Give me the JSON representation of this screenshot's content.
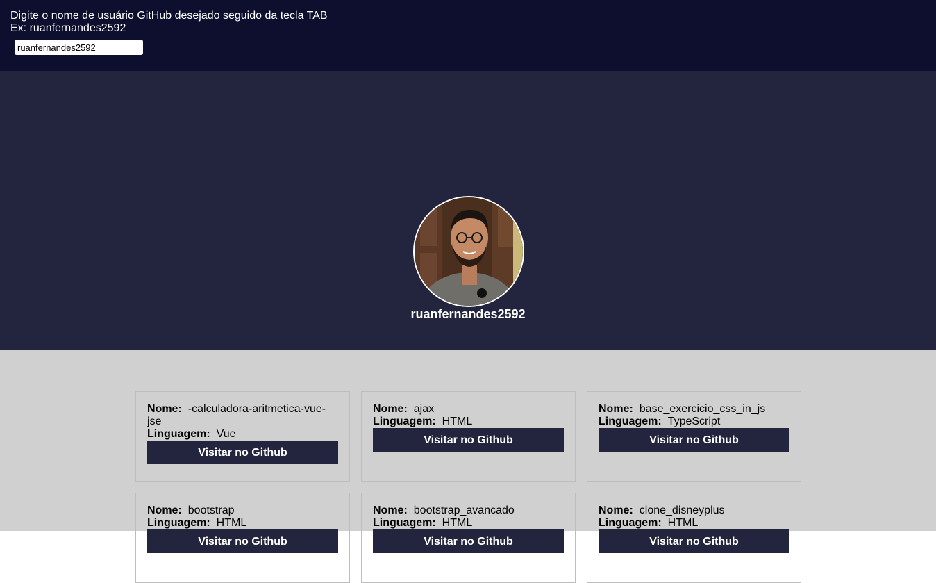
{
  "header": {
    "instruction_line1": "Digite o nome de usuário GitHub desejado seguido da tecla TAB",
    "instruction_line2": "Ex: ruanfernandes2592",
    "username_value": "ruanfernandes2592"
  },
  "profile": {
    "username": "ruanfernandes2592"
  },
  "labels": {
    "name": "Nome:",
    "language": "Linguagem:",
    "visit": "Visitar no Github"
  },
  "repos": [
    {
      "name": "-calculadora-aritmetica-vue-jse",
      "name_line1": "-calculadora-aritmetica-vue-",
      "name_line2": "jse",
      "language": "Vue"
    },
    {
      "name": "ajax",
      "language": "HTML"
    },
    {
      "name": "base_exercicio_css_in_js",
      "language": "TypeScript"
    },
    {
      "name": "bootstrap",
      "language": "HTML"
    },
    {
      "name": "bootstrap_avancado",
      "language": "HTML"
    },
    {
      "name": "clone_disneyplus",
      "language": "HTML"
    }
  ],
  "colors": {
    "header_bg": "#0e0f2e",
    "profile_bg": "#23243d",
    "repos_bg": "#d0d0d0",
    "button_bg": "#23243d"
  }
}
